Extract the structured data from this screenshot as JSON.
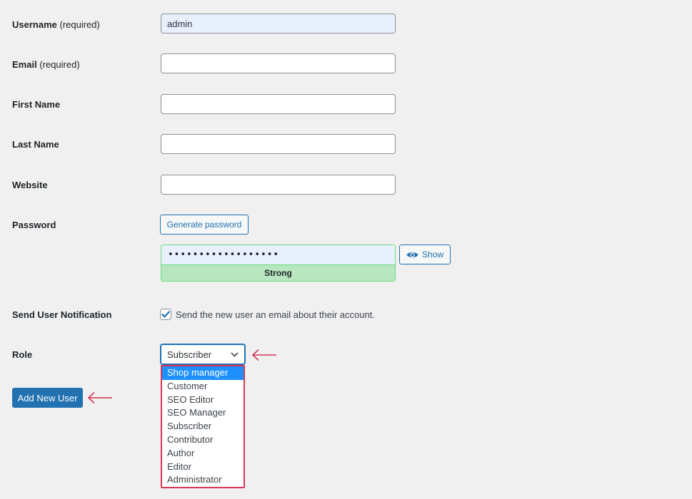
{
  "form": {
    "username": {
      "label": "Username",
      "required_note": "(required)",
      "value": "admin"
    },
    "email": {
      "label": "Email",
      "required_note": "(required)",
      "value": ""
    },
    "first_name": {
      "label": "First Name",
      "value": ""
    },
    "last_name": {
      "label": "Last Name",
      "value": ""
    },
    "website": {
      "label": "Website",
      "value": ""
    },
    "password": {
      "label": "Password",
      "generate_button": "Generate password",
      "masked_value": "••••••••••••••••••",
      "show_button": "Show",
      "strength": "Strong"
    },
    "notification": {
      "label": "Send User Notification",
      "checked": true,
      "checkbox_text": "Send the new user an email about their account."
    },
    "role": {
      "label": "Role",
      "selected": "Subscriber",
      "options": [
        "Shop manager",
        "Customer",
        "SEO Editor",
        "SEO Manager",
        "Subscriber",
        "Contributor",
        "Author",
        "Editor",
        "Administrator"
      ],
      "highlighted_option": "Shop manager"
    },
    "submit_button": "Add New User"
  },
  "colors": {
    "primary": "#2271b1",
    "annotation_arrow": "#d63654",
    "strength_strong_bg": "#b8e6bf",
    "dropdown_highlight": "#1e90ff"
  }
}
